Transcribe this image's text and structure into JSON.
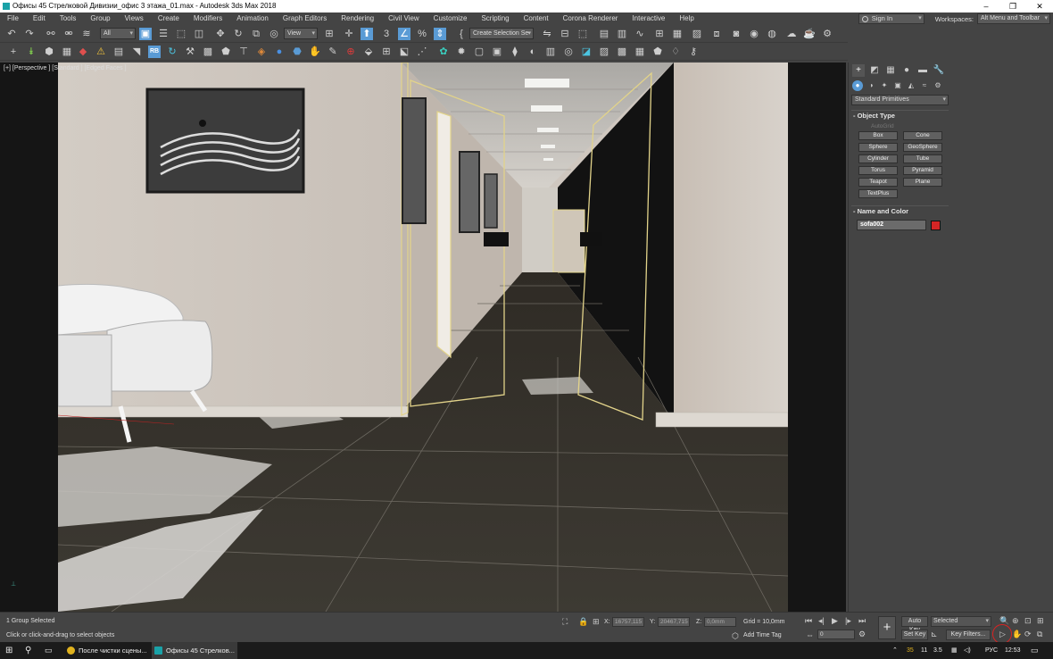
{
  "window": {
    "title": "Офисы 45 Стрелковой Дивизии_офис 3 этажа_01.max - Autodesk 3ds Max 2018",
    "controls": [
      "‒",
      "❐",
      "✕"
    ]
  },
  "menu": {
    "items": [
      "File",
      "Edit",
      "Tools",
      "Group",
      "Views",
      "Create",
      "Modifiers",
      "Animation",
      "Graph Editors",
      "Rendering",
      "Civil View",
      "Customize",
      "Scripting",
      "Content",
      "Corona Renderer",
      "Interactive",
      "Help"
    ],
    "sign_in": "Sign In",
    "workspaces_label": "Workspaces:",
    "workspace_value": "Alt Menu and Toolbar"
  },
  "toolbar": {
    "filter_select": "All",
    "view_select": "View",
    "selection_set": "Create Selection Se"
  },
  "viewport": {
    "label": "[+] [Perspective ] [Standard ] [Edged Faces ]"
  },
  "command_panel": {
    "category": "Standard Primitives",
    "object_type_title": "Object Type",
    "autogrid": "AutoGrid",
    "primitives": [
      "Box",
      "Cone",
      "Sphere",
      "GeoSphere",
      "Cylinder",
      "Tube",
      "Torus",
      "Pyramid",
      "Teapot",
      "Plane",
      "TextPlus"
    ],
    "name_color_title": "Name and Color",
    "object_name": "sofa002",
    "object_color": "#d42525"
  },
  "status": {
    "selection": "1 Group Selected",
    "prompt": "Click or click-and-drag to select objects",
    "x_label": "X:",
    "x_value": "16757,115",
    "y_label": "Y:",
    "y_value": "20467,715",
    "z_label": "Z:",
    "z_value": "0,0mm",
    "grid": "Grid = 10,0mm",
    "add_time_tag": "Add Time Tag",
    "frame": "0",
    "auto_key": "Auto Key",
    "set_key": "Set Key",
    "selected_dropdown": "Selected",
    "key_filters": "Key Filters..."
  },
  "taskbar": {
    "apps": [
      {
        "label": "После чистки сцены...",
        "color": "#e0b21e"
      },
      {
        "label": "Офисы 45 Стрелков...",
        "color": "#1aa2a8"
      }
    ],
    "tray_numbers": [
      "35",
      "11",
      "3.5"
    ],
    "language": "РУС",
    "clock": "12:53"
  }
}
